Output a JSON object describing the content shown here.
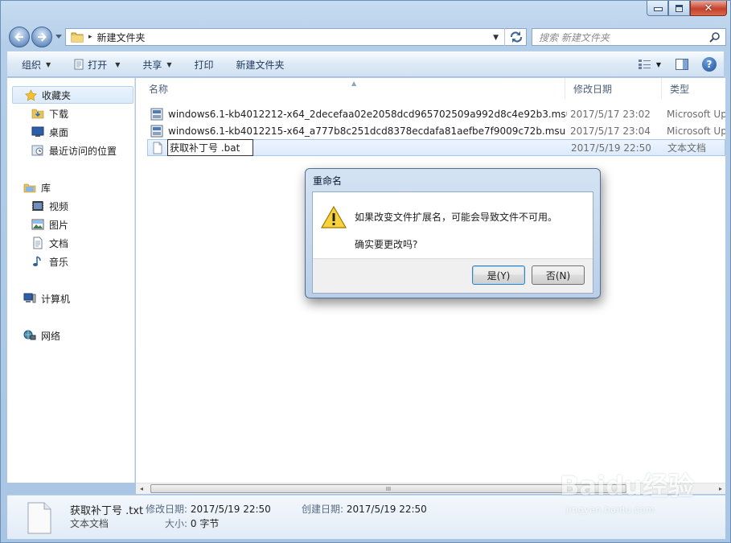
{
  "window": {
    "close_glyph": "✕"
  },
  "address": {
    "path_separator": "▸",
    "folder_name": "新建文件夹",
    "dropdown_glyph": "▼",
    "search_placeholder": "搜索 新建文件夹"
  },
  "toolbar": {
    "organize": "组织",
    "open": "打开",
    "share": "共享",
    "print": "打印",
    "new_folder": "新建文件夹",
    "caret": "▼",
    "help_glyph": "?"
  },
  "navpane": {
    "favorites": "收藏夹",
    "downloads": "下载",
    "desktop": "桌面",
    "recent": "最近访问的位置",
    "libraries": "库",
    "videos": "视频",
    "pictures": "图片",
    "documents": "文档",
    "music": "音乐",
    "computer": "计算机",
    "network": "网络"
  },
  "columns": {
    "name": "名称",
    "date": "修改日期",
    "type": "类型",
    "sort_glyph": "▲"
  },
  "files": [
    {
      "name": "windows6.1-kb4012212-x64_2decefaa02e2058dcd965702509a992d8c4e92b3.msu",
      "date": "2017/5/17 23:02",
      "type": "Microsoft Up"
    },
    {
      "name": "windows6.1-kb4012215-x64_a777b8c251dcd8378ecdafa81aefbe7f9009c72b.msu",
      "date": "2017/5/17 23:04",
      "type": "Microsoft Up"
    },
    {
      "name": "获取补丁号 .bat",
      "date": "2017/5/19 22:50",
      "type": "文本文档"
    }
  ],
  "scrollbar": {
    "left_arrow": "◂",
    "right_arrow": "▸",
    "grip": "III"
  },
  "details": {
    "file_name": "获取补丁号 .txt",
    "file_type": "文本文档",
    "modified_label": "修改日期:",
    "modified_value": "2017/5/19 22:50",
    "created_label": "创建日期:",
    "created_value": "2017/5/19 22:50",
    "size_label": "大小:",
    "size_value": "0 字节"
  },
  "watermark": {
    "logo": "Baidu经验",
    "url": "jingyan.baidu.com"
  },
  "dialog": {
    "title": "重命名",
    "message": "如果改变文件扩展名，可能会导致文件不可用。",
    "question": "确实要更改吗?",
    "yes": "是(Y)",
    "no": "否(N)"
  }
}
